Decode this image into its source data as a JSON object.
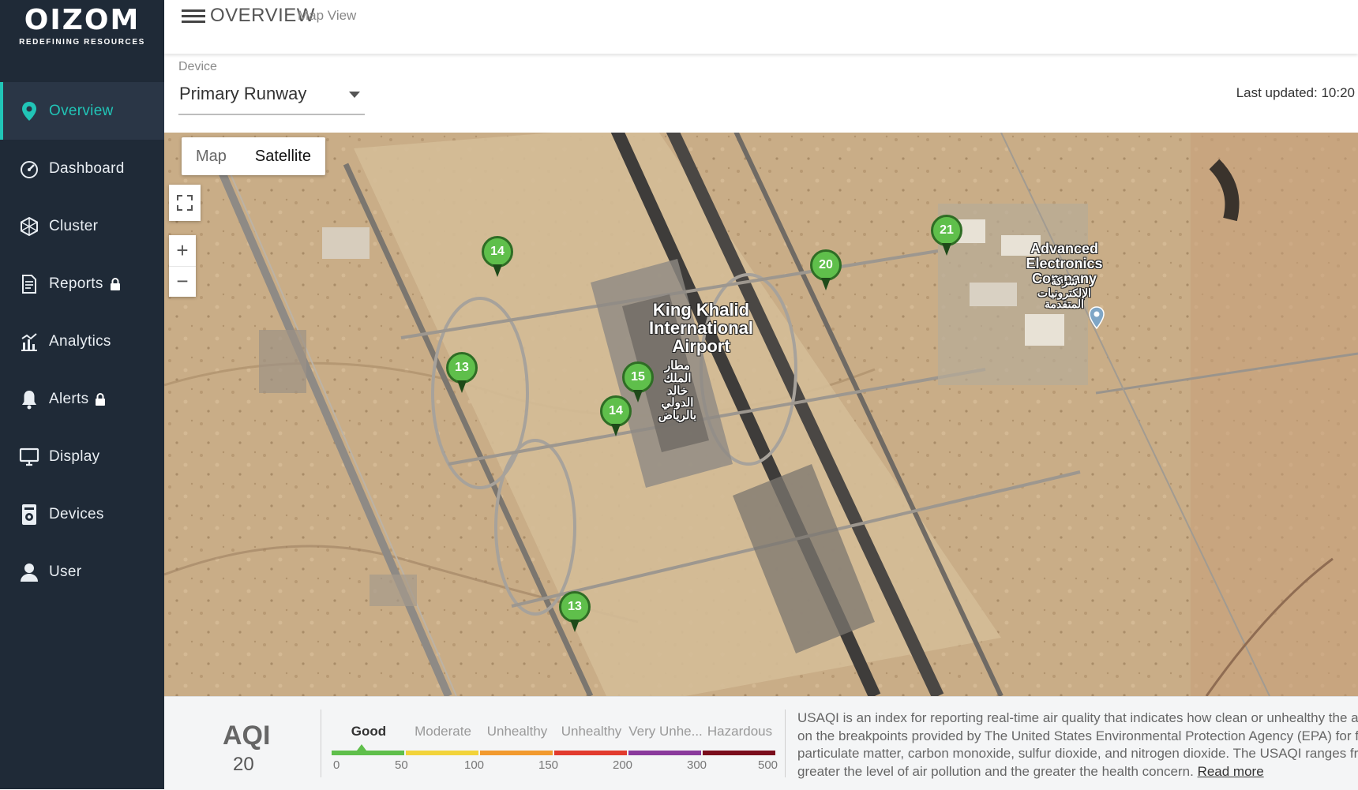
{
  "brand": {
    "name": "OIZOM",
    "tagline": "REDEFINING RESOURCES"
  },
  "sidebar": {
    "items": [
      {
        "label": "Overview",
        "icon": "map-pin-icon",
        "active": true,
        "locked": false
      },
      {
        "label": "Dashboard",
        "icon": "speedometer-icon",
        "active": false,
        "locked": false
      },
      {
        "label": "Cluster",
        "icon": "cluster-icon",
        "active": false,
        "locked": false
      },
      {
        "label": "Reports",
        "icon": "report-icon",
        "active": false,
        "locked": true
      },
      {
        "label": "Analytics",
        "icon": "analytics-icon",
        "active": false,
        "locked": false
      },
      {
        "label": "Alerts",
        "icon": "bell-icon",
        "active": false,
        "locked": true
      },
      {
        "label": "Display",
        "icon": "monitor-icon",
        "active": false,
        "locked": false
      },
      {
        "label": "Devices",
        "icon": "device-icon",
        "active": false,
        "locked": false
      },
      {
        "label": "User",
        "icon": "user-icon",
        "active": false,
        "locked": false
      }
    ]
  },
  "header": {
    "title": "OVERVIEW",
    "subtitle": "Map View"
  },
  "device": {
    "label": "Device",
    "selected": "Primary Runway"
  },
  "last_updated": "Last updated: 10:20",
  "map": {
    "type_options": [
      "Map",
      "Satellite"
    ],
    "selected_type": "Satellite",
    "controls": {
      "zoom_in": "+",
      "zoom_out": "−"
    },
    "markers": [
      "14",
      "13",
      "15",
      "14",
      "13",
      "20",
      "21"
    ],
    "labels": {
      "airport": "King Khalid International Airport",
      "airport_arabic": "مطار الملك خالد الدولي بالرياض",
      "company": "Advanced Electronics Company",
      "company_arabic": "شركة الإلكترونيات المتقدمة"
    }
  },
  "aqi": {
    "title": "AQI",
    "value": "20",
    "categories": [
      {
        "label": "Good",
        "color": "#5fbf4b",
        "selected": true
      },
      {
        "label": "Moderate",
        "color": "#f2d33a",
        "selected": false
      },
      {
        "label": "Unhealthy",
        "color": "#f29a2e",
        "selected": false
      },
      {
        "label": "Unhealthy",
        "color": "#e23b2e",
        "selected": false
      },
      {
        "label": "Very Unhe...",
        "color": "#8a3a9c",
        "selected": false
      },
      {
        "label": "Hazardous",
        "color": "#7a0d1c",
        "selected": false
      }
    ],
    "ticks": [
      "0",
      "50",
      "100",
      "150",
      "200",
      "300",
      "500"
    ],
    "description_lines": [
      "USAQI is an index for reporting real-time air quality that indicates how clean or unhealthy the amb",
      "on the breakpoints provided by The United States Environmental Protection Agency (EPA) for five",
      "particulate matter, carbon monoxide, sulfur dioxide, and nitrogen dioxide. The USAQI ranges from",
      "greater the level of air pollution and the greater the health concern."
    ],
    "read_more": "Read more"
  },
  "colors": {
    "sidebar_bg": "#1f2a37",
    "accent": "#21c5b7",
    "marker_green": "#5fbf4b"
  }
}
